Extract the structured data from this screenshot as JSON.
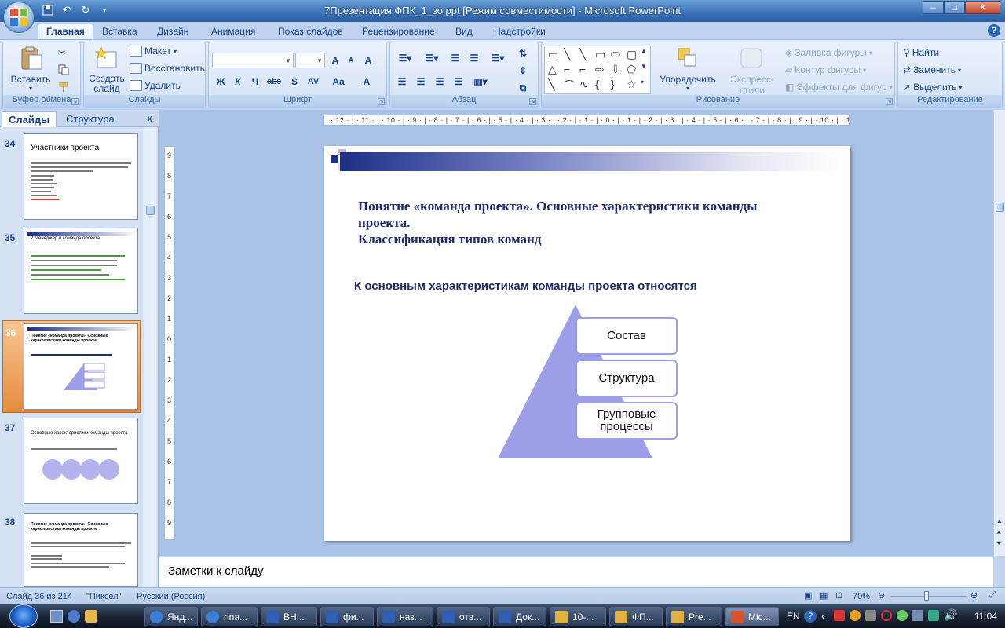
{
  "window": {
    "title": "7Презентация ФПК_1_зо.ppt [Режим совместимости] - Microsoft PowerPoint"
  },
  "ribbon_tabs": [
    "Главная",
    "Вставка",
    "Дизайн",
    "Анимация",
    "Показ слайдов",
    "Рецензирование",
    "Вид",
    "Надстройки"
  ],
  "ribbon": {
    "clipboard": {
      "label": "Буфер обмена",
      "paste": "Вставить"
    },
    "slides": {
      "label": "Слайды",
      "new_slide": "Создать слайд",
      "layout": "Макет",
      "reset": "Восстановить",
      "delete": "Удалить"
    },
    "font": {
      "label": "Шрифт",
      "bold": "Ж",
      "italic": "К",
      "underline": "Ч",
      "strike": "abc",
      "shadow": "S",
      "spacing": "AV",
      "case": "Aa",
      "grow": "A",
      "shrink": "A",
      "clear": "A",
      "color": "A"
    },
    "paragraph": {
      "label": "Абзац"
    },
    "drawing": {
      "label": "Рисование",
      "arrange": "Упорядочить",
      "quick_styles": "Экспресс-стили",
      "fill": "Заливка фигуры",
      "outline": "Контур фигуры",
      "effects": "Эффекты для фигур"
    },
    "editing": {
      "label": "Редактирование",
      "find": "Найти",
      "replace": "Заменить",
      "select": "Выделить"
    }
  },
  "left_panel": {
    "tabs": [
      "Слайды",
      "Структура"
    ],
    "close": "x",
    "thumbnails": [
      {
        "num": "34",
        "title": "Участники проекта"
      },
      {
        "num": "35",
        "title": "2.Менеджер и команда проекта"
      },
      {
        "num": "36",
        "title": "Понятие «команда проекта». Основные характеристики команды проекта."
      },
      {
        "num": "37",
        "title": "Основные характеристики команды проекта"
      },
      {
        "num": "38",
        "title": "Понятие «команда проекта». Основные характеристики команды проекта."
      }
    ]
  },
  "rulers": {
    "horizontal": "· 12 · | · 11 · | · 10 · | · 9 · | · 8 · | · 7 · | · 6 · | · 5 · | · 4 · | · 3 · | · 2 · | · 1 · | · 0 · | · 1 · | · 2 · | · 3 · | · 4 · | · 5 · | · 6 · | · 7 · | · 8 · | · 9 · | · 10 · | · 11 · | · 12 ·",
    "vertical": [
      "9",
      "8",
      "7",
      "6",
      "5",
      "4",
      "3",
      "2",
      "1",
      "0",
      "1",
      "2",
      "3",
      "4",
      "5",
      "6",
      "7",
      "8",
      "9"
    ]
  },
  "slide": {
    "title_line1": "Понятие «команда проекта». Основные характеристики команды",
    "title_line2": "проекта.",
    "title_line3": "Классификация типов команд",
    "subtitle": "К основным характеристикам команды проекта относятся",
    "pyramid_items": [
      "Состав",
      "Структура",
      "Групповые процессы"
    ],
    "band_color": "#1c2f86",
    "pyramid_color": "#9d9ee8"
  },
  "notes": {
    "placeholder": "Заметки к слайду"
  },
  "status": {
    "slide_of": "Слайд 36 из 214",
    "theme": "\"Пиксел\"",
    "language": "Русский (Россия)",
    "zoom": "70%"
  },
  "taskbar": {
    "items": [
      "Янд...",
      "rina...",
      "ВН...",
      "фи...",
      "наз...",
      "отв...",
      "Док...",
      "10-...",
      "ФП...",
      "Pre...",
      "Mic..."
    ],
    "lang": "EN",
    "time": "11:04"
  }
}
